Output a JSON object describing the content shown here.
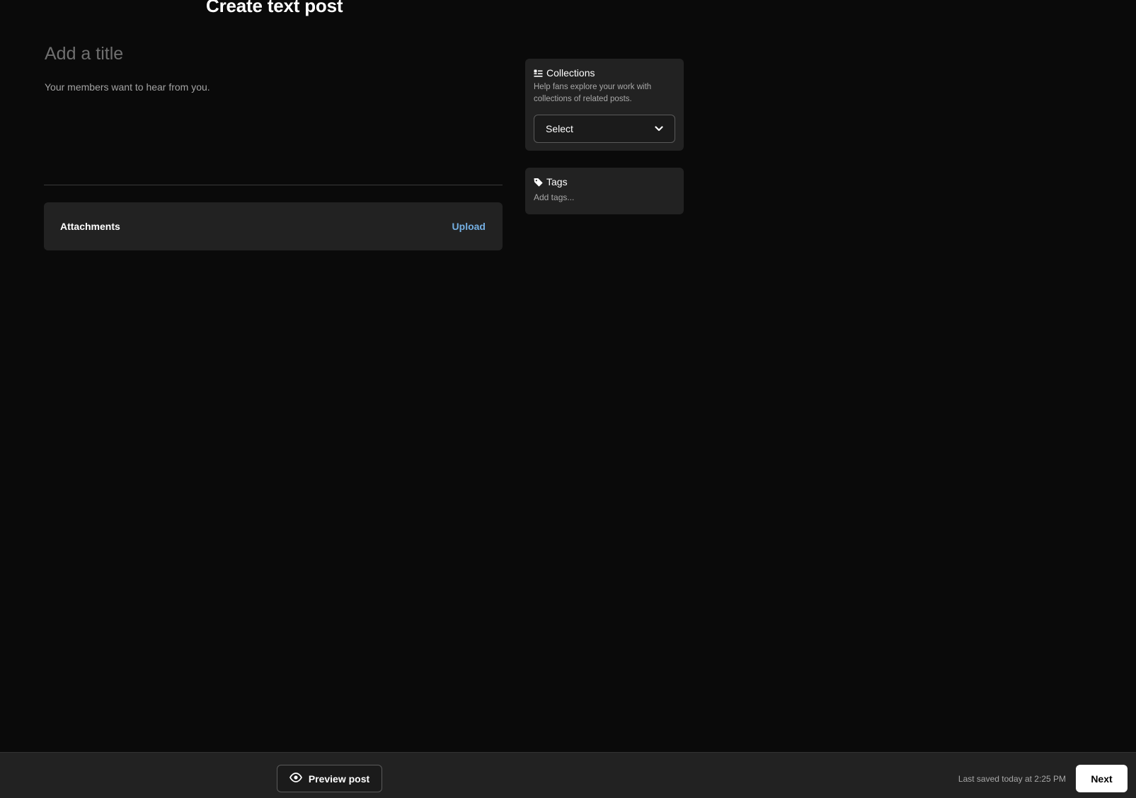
{
  "page": {
    "title": "Create text post"
  },
  "editor": {
    "title_placeholder": "Add a title",
    "body_placeholder": "Your members want to hear from you."
  },
  "attachments": {
    "label": "Attachments",
    "upload_label": "Upload"
  },
  "collections": {
    "icon": "collections-icon",
    "title": "Collections",
    "description": "Help fans explore your work with collections of related posts.",
    "select_value": "Select"
  },
  "tags": {
    "icon": "tag-icon",
    "title": "Tags",
    "placeholder": "Add tags..."
  },
  "footer": {
    "preview_label": "Preview post",
    "saved_status": "Last saved today at 2:25 PM",
    "next_label": "Next"
  },
  "colors": {
    "background": "#0a0a0a",
    "panel": "#222222",
    "link": "#74afe2",
    "primary_button": "#ffffff"
  }
}
